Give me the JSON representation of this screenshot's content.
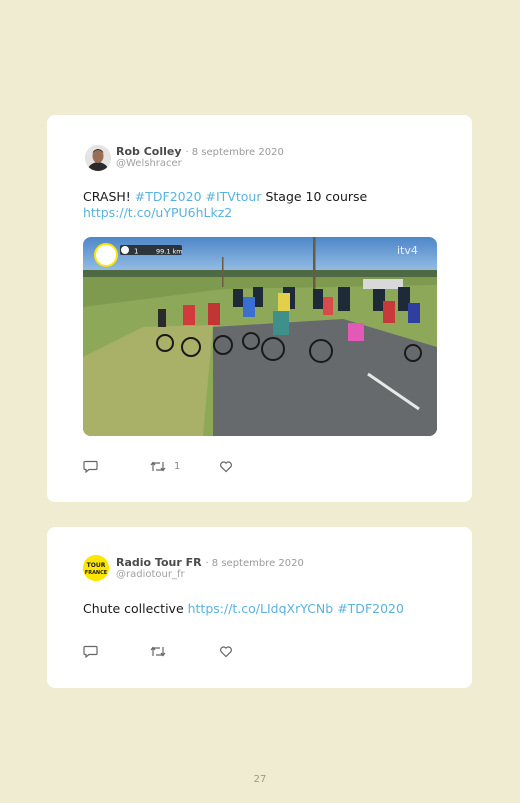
{
  "tweets": [
    {
      "author": "Rob Colley",
      "date": "· 8 septembre 2020",
      "handle": "@Welshracer",
      "text_lead": "CRASH! ",
      "hashtags": [
        "#TDF2020",
        "#ITVtour"
      ],
      "text_tail": " Stage 10 course",
      "link": "https://t.co/uYPU6hLkz2",
      "media": {
        "overlay_distance": "99.1 km",
        "overlay_number": "1",
        "broadcaster": "itv4"
      },
      "actions": {
        "reply_count": "",
        "retweet_count": "1",
        "like_count": ""
      }
    },
    {
      "author": "Radio Tour FR",
      "date": "· 8 septembre 2020",
      "handle": "@radiotour_fr",
      "text_lead": "Chute collective ",
      "link": "https://t.co/LIdqXrYCNb",
      "hashtag": "#TDF2020",
      "avatar_logo_text": "TOUR DE FRANCE",
      "actions": {
        "reply_count": "",
        "retweet_count": "",
        "like_count": ""
      }
    }
  ],
  "page": {
    "number": "27"
  },
  "colors": {
    "background": "#efecd2",
    "card": "#ffffff",
    "link": "#5bb2df",
    "avatar_yellow": "#ffe600"
  },
  "icons": [
    "reply-icon",
    "retweet-icon",
    "like-icon"
  ]
}
